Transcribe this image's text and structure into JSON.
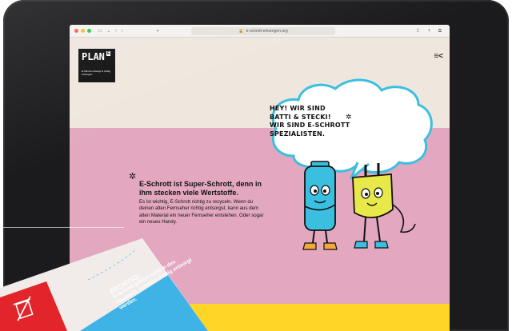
{
  "browser": {
    "url": "e-schrott-entsorgen.org"
  },
  "site": {
    "logo_word": "PLAN",
    "logo_badge": "E",
    "logo_tagline": "E-Schrott entsorgt & richtig entsorgen"
  },
  "speech_bubble": {
    "lines": [
      "HEY! WIR SIND",
      "BATTI & STECKI!",
      "WIR SIND E-SCHROTT",
      "SPEZIALISTEN."
    ]
  },
  "article": {
    "headline": "E-Schrott ist Super-Schrott, denn in ihm stecken viele Wertstoffe.",
    "body": "Es ist wichtig, E-Schrott richtig zu recyceln. Wenn du deinen alten Fernseher richtig entsorgst, kann aus dem alten Material ein neuer Fernseher entstehen. Oder sogar ein neues Handy."
  },
  "leaflet": {
    "title": "RICHTIG:",
    "text": "E-Schrott gehört nicht in den Hausmüll, sondern richtig entsorgt werden."
  },
  "colors": {
    "cream": "#efe7de",
    "pink": "#e3a8bf",
    "yellow": "#ffd526",
    "battery_blue": "#3bbfe0",
    "plug_yellow": "#e8e84a",
    "leaflet_red": "#e2242b",
    "leaflet_blue": "#3fb2e6"
  }
}
